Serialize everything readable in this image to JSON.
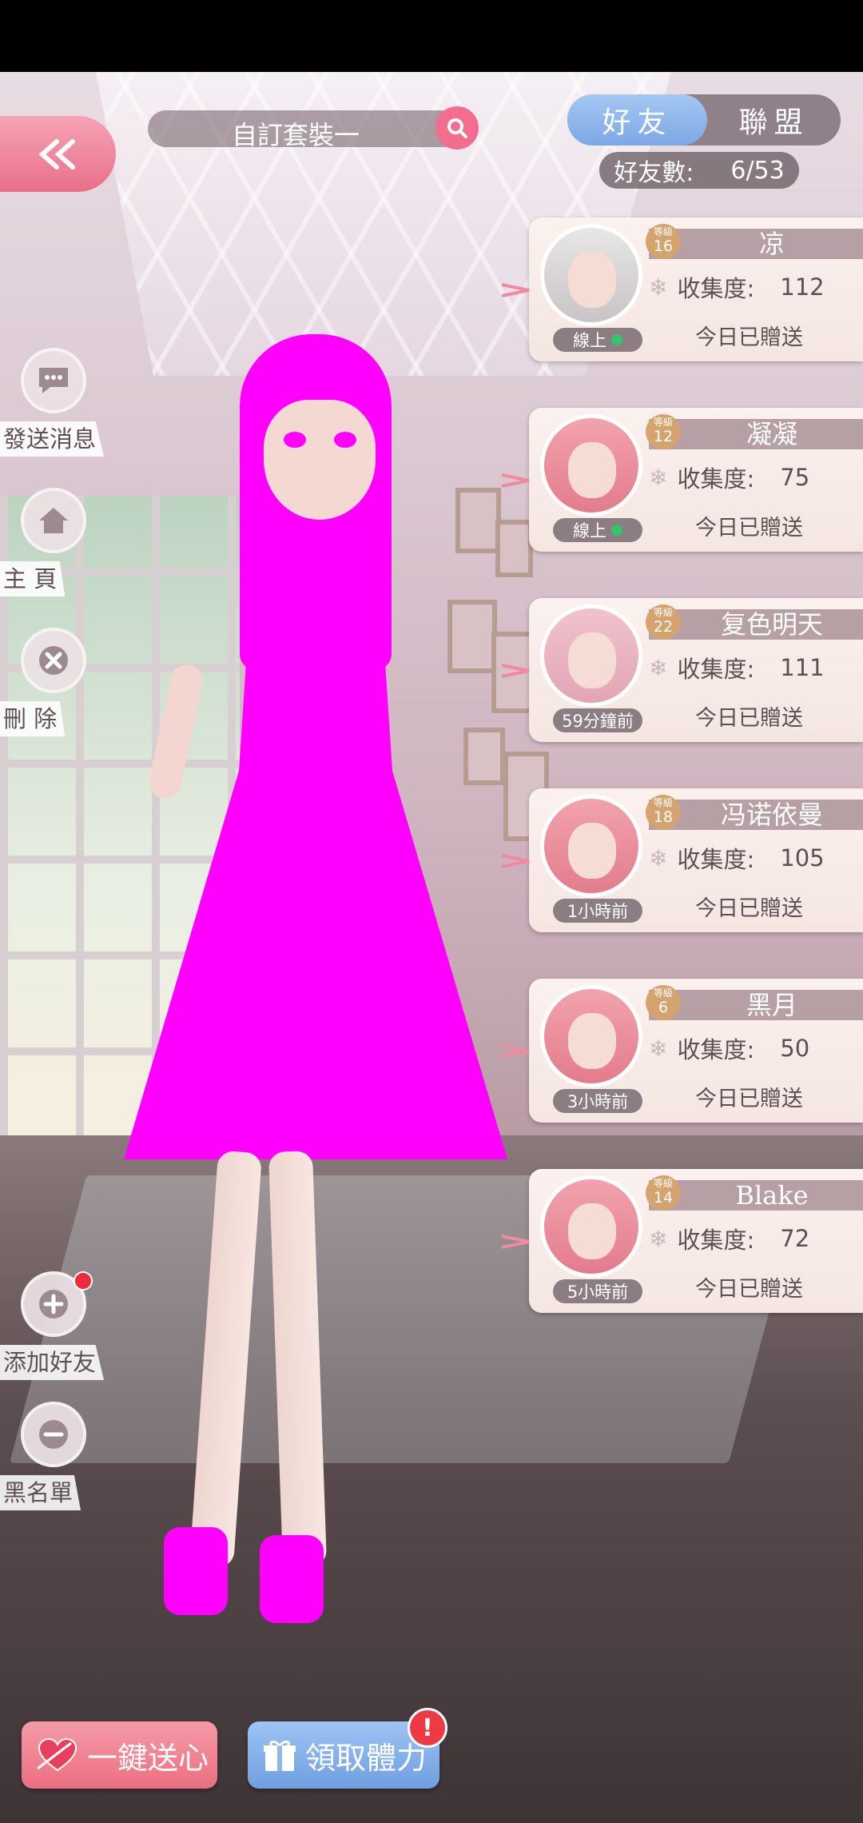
{
  "header": {
    "outfit_name": "自訂套裝一",
    "tabs": [
      {
        "label": "好友",
        "active": true
      },
      {
        "label": "聯盟",
        "active": false
      }
    ],
    "friend_count_label": "好友數:",
    "friend_count_value": "6/53"
  },
  "side_menu": {
    "send_message": "發送消息",
    "home": "主 頁",
    "delete": "刪 除",
    "add_friend": "添加好友",
    "blacklist": "黑名單"
  },
  "friends": [
    {
      "level_caption": "等級",
      "level": "16",
      "name": "凉",
      "collect_label": "收集度:",
      "collect": "112",
      "sent": "今日已贈送",
      "status": "線上",
      "online": true
    },
    {
      "level_caption": "等級",
      "level": "12",
      "name": "凝凝",
      "collect_label": "收集度:",
      "collect": "75",
      "sent": "今日已贈送",
      "status": "線上",
      "online": true
    },
    {
      "level_caption": "等級",
      "level": "22",
      "name": "复色明天",
      "collect_label": "收集度:",
      "collect": "111",
      "sent": "今日已贈送",
      "status": "59分鐘前",
      "online": false
    },
    {
      "level_caption": "等級",
      "level": "18",
      "name": "冯诺依曼",
      "collect_label": "收集度:",
      "collect": "105",
      "sent": "今日已贈送",
      "status": "1小時前",
      "online": false
    },
    {
      "level_caption": "等級",
      "level": "6",
      "name": "黑月",
      "collect_label": "收集度:",
      "collect": "50",
      "sent": "今日已贈送",
      "status": "3小時前",
      "online": false
    },
    {
      "level_caption": "等級",
      "level": "14",
      "name": "Blake",
      "collect_label": "收集度:",
      "collect": "72",
      "sent": "今日已贈送",
      "status": "5小時前",
      "online": false
    }
  ],
  "bottom": {
    "send_hearts": "一鍵送心",
    "claim_stamina": "領取體力",
    "alert_mark": "!"
  },
  "colors": {
    "accent_pink": "#ec6f80",
    "accent_blue": "#7da8e6",
    "online_green": "#35c46b",
    "level_gold": "#d4a36e"
  }
}
